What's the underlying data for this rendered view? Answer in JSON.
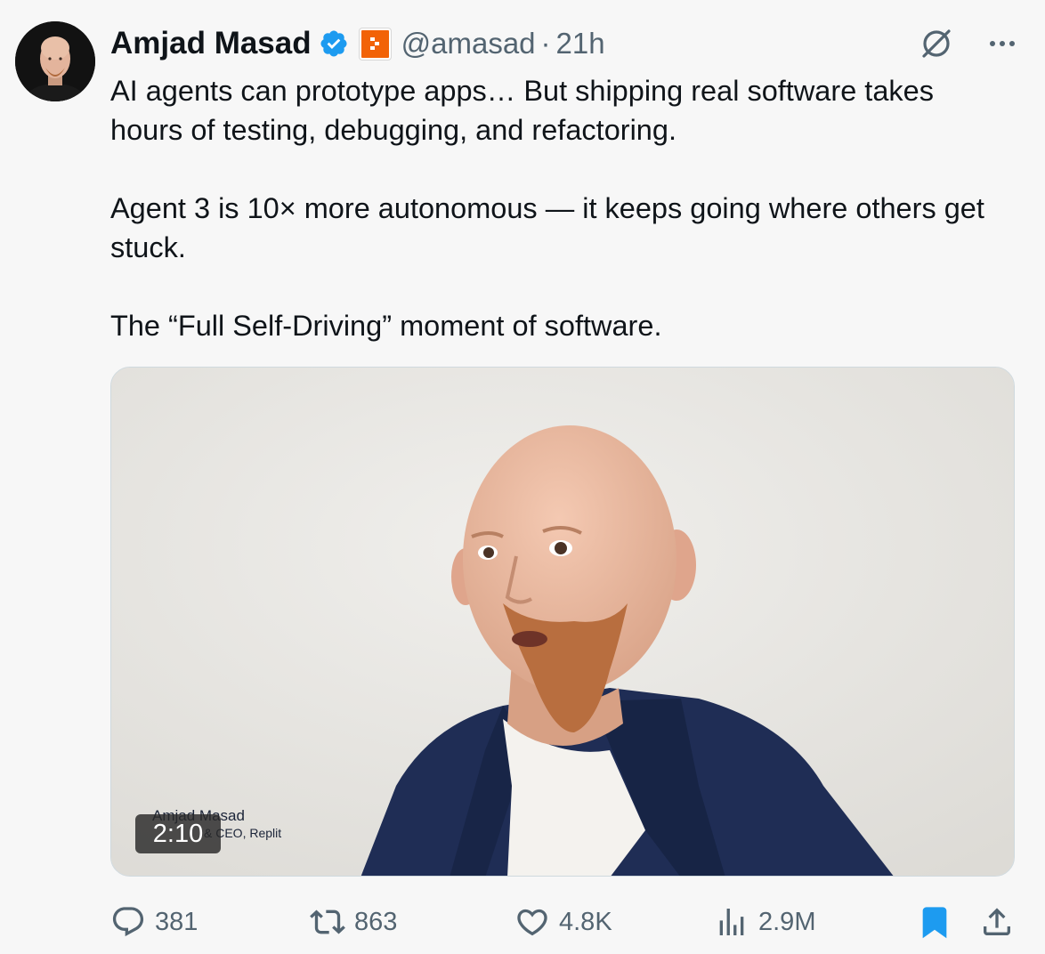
{
  "author": {
    "name": "Amjad Masad",
    "handle": "@amasad",
    "separator": "·",
    "time": "21h",
    "verified_icon": "verified-badge-icon",
    "affiliate_icon": "replit-logo-icon"
  },
  "tweet": {
    "paragraphs": [
      "AI agents can prototype apps… But shipping real software takes hours of testing, debugging, and refactoring.",
      "Agent 3 is 10× more autonomous — it keeps going where others get stuck.",
      "The “Full Self-Driving” moment of software."
    ]
  },
  "media": {
    "lower_third_name": "Amjad Masad",
    "lower_third_title": "& CEO, Replit",
    "duration": "2:10"
  },
  "actions": {
    "replies": "381",
    "reposts": "863",
    "likes": "4.8K",
    "views": "2.9M"
  },
  "colors": {
    "accent": "#1d9bf0",
    "secondary_text": "#536471",
    "replit_orange": "#f26207",
    "background": "#f7f7f7"
  }
}
